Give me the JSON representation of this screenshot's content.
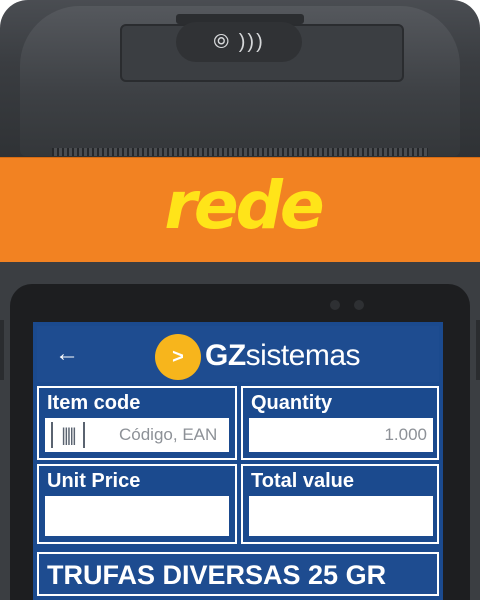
{
  "device": {
    "brand_logo": "rede",
    "contactless_icon": "contactless-icon"
  },
  "appbar": {
    "back_icon": "←",
    "brand_mark": ">",
    "brand_prefix": "GZ",
    "brand_suffix": "sistemas"
  },
  "form": {
    "item_code": {
      "label": "Item code",
      "placeholder": "Código, EAN",
      "barcode_icon": "barcode-icon"
    },
    "quantity": {
      "label": "Quantity",
      "value": "1.000"
    },
    "unit_price": {
      "label": "Unit Price",
      "value": ""
    },
    "total_value": {
      "label": "Total value",
      "value": ""
    }
  },
  "product": {
    "name": "TRUFAS DIVERSAS 25 GR"
  },
  "colors": {
    "band_orange": "#f28222",
    "logo_yellow": "#ffe419",
    "screen_blue": "#1b4a8e",
    "brand_yellow": "#f7b51c"
  }
}
